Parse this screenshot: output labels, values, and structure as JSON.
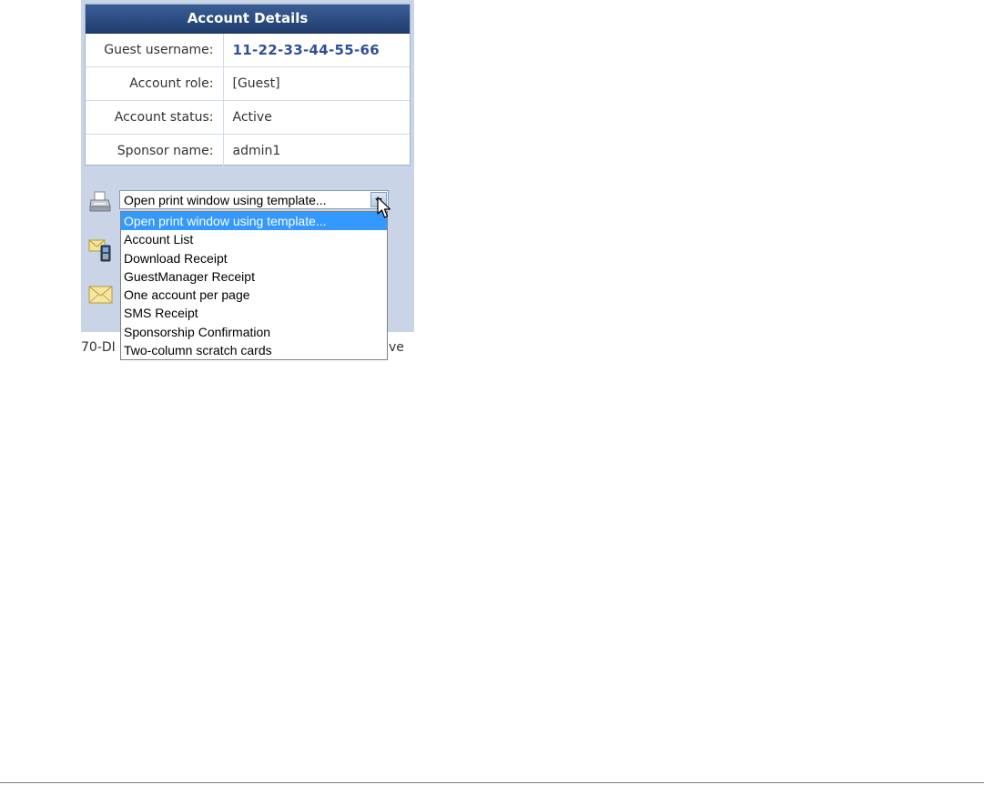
{
  "account_details": {
    "title": "Account Details",
    "rows": [
      {
        "label": "Guest username:",
        "value": "11-22-33-44-55-66"
      },
      {
        "label": "Account role:",
        "value": "[Guest]"
      },
      {
        "label": "Account status:",
        "value": "Active"
      },
      {
        "label": "Sponsor name:",
        "value": "admin1"
      }
    ]
  },
  "print_select": {
    "selected": "Open print window using template...",
    "options": [
      "Open print window using template...",
      "Account List",
      "Download Receipt",
      "GuestManager Receipt",
      "One account per page",
      "SMS Receipt",
      "Sponsorship Confirmation",
      "Two-column scratch cards"
    ]
  },
  "partial_text": {
    "left": "70-DI",
    "right": "ve"
  },
  "icons": {
    "print": "printer-icon",
    "sms": "sms-phone-icon",
    "email": "email-envelope-icon"
  },
  "colors": {
    "header_bg": "#1f3d6e",
    "username_text": "#2f4f9a",
    "panel_bg": "#c9d5e6",
    "selected_option_bg": "#3399ff"
  }
}
